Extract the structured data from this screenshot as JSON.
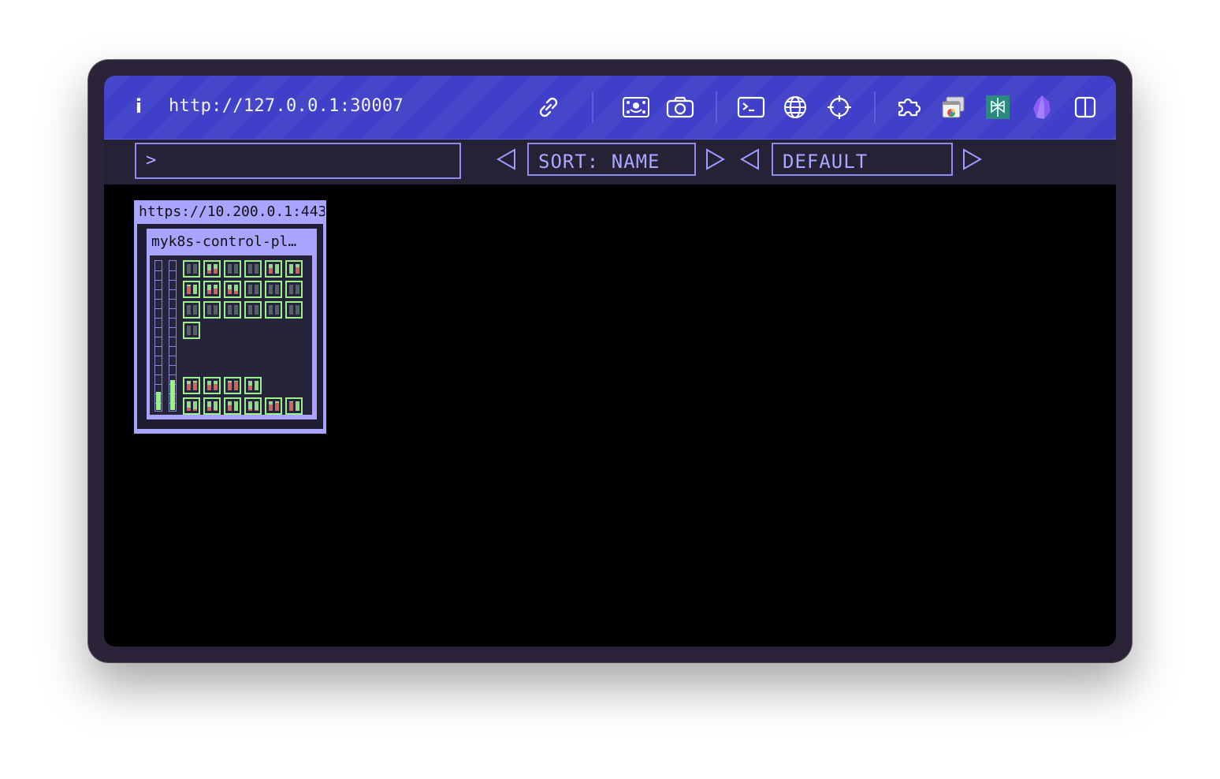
{
  "topbar": {
    "url": "http://127.0.0.1:30007",
    "icons": [
      "info-icon",
      "link-icon",
      "screencast-icon",
      "camera-icon",
      "terminal-icon",
      "globe-icon",
      "crosshair-icon",
      "puzzle-icon",
      "window-stack-icon",
      "perplexity-icon",
      "obsidian-icon",
      "split-view-icon"
    ]
  },
  "toolbar": {
    "command_prompt": ">",
    "sort_label": "SORT: NAME",
    "theme_label": "DEFAULT"
  },
  "cluster": {
    "url": "https://10.200.0.1:443",
    "nodes": [
      {
        "name": "myk8s-control-pl…",
        "cpu_gauge": 0.12,
        "mem_gauge": 0.2,
        "pods_top": [
          [
            0.0,
            0.0
          ],
          [
            0.3,
            0.5
          ],
          [
            0.0,
            0.0
          ],
          [
            0.0,
            0.0
          ],
          [
            0.6,
            0.0
          ],
          [
            0.0,
            0.7
          ],
          [
            0.8,
            0.0
          ],
          [
            0.4,
            0.6
          ],
          [
            0.5,
            0.3
          ],
          [
            0.0,
            0.0
          ],
          [
            0.0,
            0.0
          ],
          [
            0.0,
            0.0
          ],
          [
            0.0,
            0.0
          ],
          [
            0.0,
            0.0
          ],
          [
            0.0,
            0.0
          ],
          [
            0.0,
            0.0
          ],
          [
            0.0,
            0.0
          ],
          [
            0.0,
            0.0
          ],
          [
            0.0,
            0.0
          ]
        ],
        "pods_bottom": [
          [
            0.7,
            0.8
          ],
          [
            0.6,
            0.7
          ],
          [
            0.8,
            0.9
          ],
          [
            0.5,
            0.0
          ],
          [
            0.3,
            0.2
          ],
          [
            0.4,
            0.1
          ],
          [
            0.6,
            0.0
          ],
          [
            0.2,
            0.1
          ],
          [
            0.7,
            0.8
          ],
          [
            0.9,
            0.0
          ]
        ]
      }
    ]
  },
  "colors": {
    "topbar": "#3f3fc9",
    "accent": "#a9a4ff",
    "pod_ok": "#9cf08a",
    "pod_usage": "#e36b5e"
  }
}
